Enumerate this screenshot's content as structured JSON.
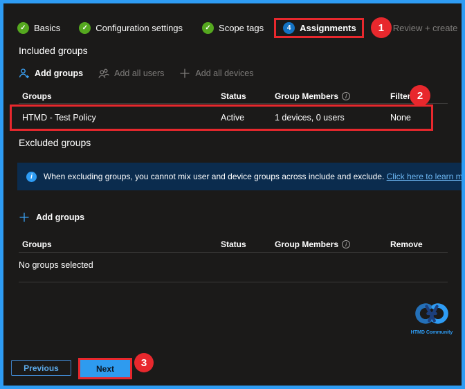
{
  "theme": {
    "frame_border": "#2e9cf4",
    "background": "#1b1a19",
    "annotation_red": "#e8282d",
    "step_green": "#55a81f",
    "step_blue": "#1373c4",
    "banner_bg": "#0b2c4e",
    "link_color": "#6cb6f2",
    "next_button_bg": "#2e9bef"
  },
  "icons": {
    "check": "✓",
    "plus": "+",
    "info": "i"
  },
  "stepper": {
    "steps": [
      {
        "label": "Basics",
        "state": "done"
      },
      {
        "label": "Configuration settings",
        "state": "done"
      },
      {
        "label": "Scope tags",
        "state": "done"
      },
      {
        "label": "Assignments",
        "state": "current",
        "number": "4"
      },
      {
        "label": "Review + create",
        "state": "upcoming"
      }
    ]
  },
  "included": {
    "title": "Included groups",
    "actions": [
      {
        "label": "Add groups",
        "enabled": true
      },
      {
        "label": "Add all users",
        "enabled": false
      },
      {
        "label": "Add all devices",
        "enabled": false
      }
    ],
    "table": {
      "headers": [
        "Groups",
        "Status",
        "Group Members",
        "Filter"
      ],
      "rows": [
        {
          "group": "HTMD - Test Policy",
          "status": "Active",
          "members": "1 devices, 0 users",
          "filter": "None"
        }
      ]
    }
  },
  "excluded": {
    "title": "Excluded groups",
    "banner": {
      "text": "When excluding groups, you cannot mix user and device groups across include and exclude. ",
      "link": "Click here to learn more about"
    },
    "add_groups_label": "Add groups",
    "table": {
      "headers": [
        "Groups",
        "Status",
        "Group Members",
        "Remove"
      ],
      "empty_text": "No groups selected"
    }
  },
  "footer": {
    "previous_label": "Previous",
    "next_label": "Next"
  },
  "logo": {
    "caption": "HTMD Community"
  },
  "annotations": {
    "badge1": "1",
    "badge2": "2",
    "badge3": "3"
  }
}
